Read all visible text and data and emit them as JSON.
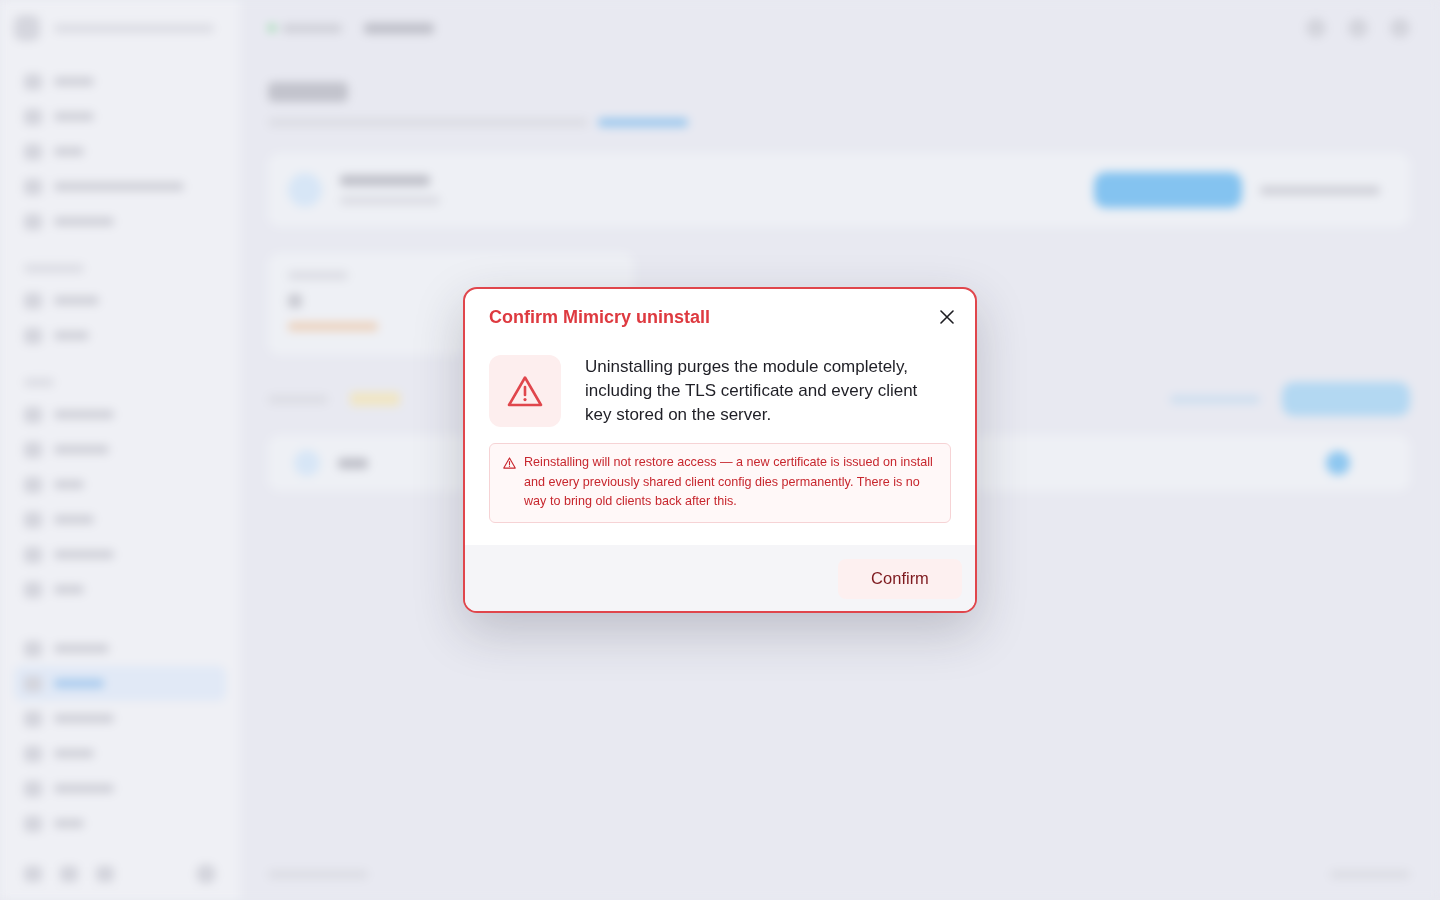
{
  "dialog": {
    "title": "Confirm Mimicry uninstall",
    "message": "Uninstalling purges the module completely, including the TLS certificate and every client key stored on the server.",
    "warning": "Reinstalling will not restore access — a new certificate is issued on install and every previously shared client config dies permanently. There is no way to bring old clients back after this.",
    "confirm_button": {
      "label": "Confirm"
    }
  }
}
